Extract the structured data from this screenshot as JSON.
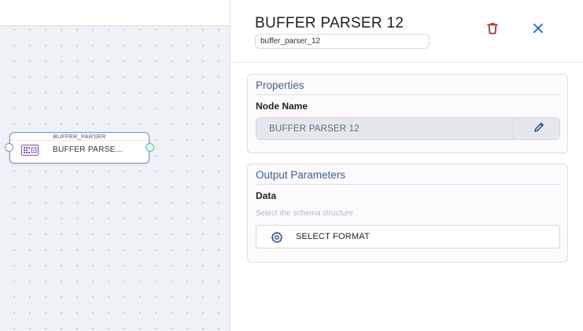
{
  "canvas": {
    "node": {
      "type_label": "BUFFER_PARSER",
      "label": "BUFFER PARSE..."
    }
  },
  "panel": {
    "title": "BUFFER PARSER 12",
    "node_id": "buffer_parser_12",
    "delete_icon": "trash-icon",
    "close_icon": "close-icon",
    "properties": {
      "heading": "Properties",
      "node_name_label": "Node Name",
      "node_name_value": "BUFFER PARSER 12",
      "edit_icon": "pencil-icon"
    },
    "output": {
      "heading": "Output Parameters",
      "data_label": "Data",
      "hint": "Select the schema structure",
      "select_format_label": "SELECT FORMAT",
      "select_format_icon": "gear-icon"
    }
  },
  "colors": {
    "accent": "#3b5f9a",
    "delete": "#c62828",
    "close": "#1e63c4",
    "node_border": "#6d93d6",
    "output_port": "#42c58e"
  }
}
